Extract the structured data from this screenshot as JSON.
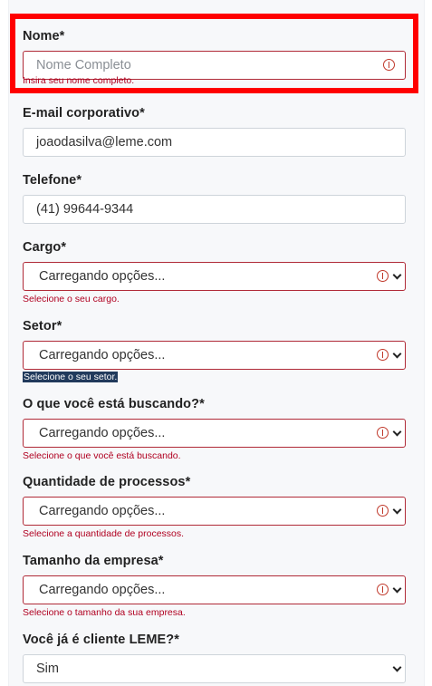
{
  "form": {
    "nome": {
      "label": "Nome*",
      "placeholder": "Nome Completo",
      "value": "",
      "error": "Insira seu nome completo."
    },
    "email": {
      "label": "E-mail corporativo*",
      "value": "joaodasilva@leme.com"
    },
    "telefone": {
      "label": "Telefone*",
      "value": "(41) 99644-9344"
    },
    "cargo": {
      "label": "Cargo*",
      "selected": "Carregando opções...",
      "error": "Selecione o seu cargo."
    },
    "setor": {
      "label": "Setor*",
      "selected": "Carregando opções...",
      "error": "Selecione o seu setor."
    },
    "buscando": {
      "label": "O que você está buscando?*",
      "selected": "Carregando opções...",
      "error": "Selecione o que você está buscando."
    },
    "processos": {
      "label": "Quantidade de processos*",
      "selected": "Carregando opções...",
      "error": "Selecione a quantidade de processos."
    },
    "tamanho": {
      "label": "Tamanho da empresa*",
      "selected": "Carregando opções...",
      "error": "Selecione o tamanho da sua empresa."
    },
    "cliente": {
      "label": "Você já é cliente LEME?*",
      "selected": "Sim"
    }
  },
  "colors": {
    "error": "#b02a37",
    "highlight": "#ff0000",
    "focus_bg": "#213a5c"
  },
  "icons": [
    "alert-circle-icon",
    "chevron-down-icon"
  ]
}
